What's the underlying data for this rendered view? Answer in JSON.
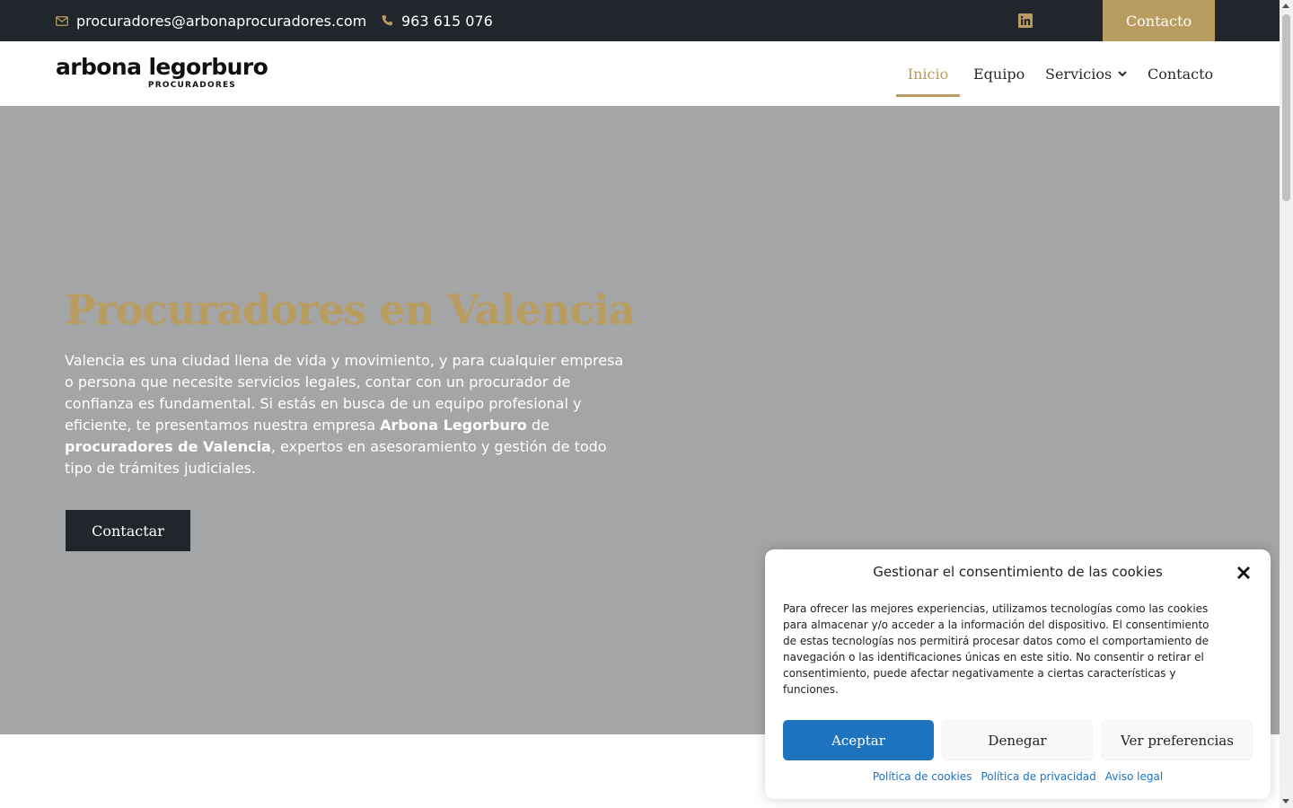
{
  "topbar": {
    "email": "procuradores@arbonaprocuradores.com",
    "phone": "963 615 076",
    "contact_button": "Contacto",
    "social_icon": "linkedin-icon"
  },
  "header": {
    "logo_main": "arbona legorburo",
    "logo_sub": "PROCURADORES",
    "nav": {
      "inicio": "Inicio",
      "equipo": "Equipo",
      "servicios": "Servicios",
      "contacto": "Contacto"
    },
    "active_item": "Inicio"
  },
  "hero": {
    "title": "Procuradores en Valencia",
    "text_part1": "Valencia es una ciudad llena de vida y movimiento, y para cualquier empresa o persona que necesite servicios legales, contar con un procurador de confianza es fundamental. Si estás en busca de un equipo profesional y eficiente, te presentamos nuestra empresa ",
    "text_bold1": "Arbona Legorburo",
    "text_part2": " de ",
    "text_bold2": "procuradores de Valencia",
    "text_part3": ", expertos en asesoramiento y gestión de todo tipo de trámites judiciales.",
    "button": "Contactar"
  },
  "cookie_dialog": {
    "title": "Gestionar el consentimiento de las cookies",
    "body": "Para ofrecer las mejores experiencias, utilizamos tecnologías como las cookies para almacenar y/o acceder a la información del dispositivo. El consentimiento de estas tecnologías nos permitirá procesar datos como el comportamiento de navegación o las identificaciones únicas en este sitio. No consentir o retirar el consentimiento, puede afectar negativamente a ciertas características y funciones.",
    "accept": "Aceptar",
    "deny": "Denegar",
    "preferences": "Ver preferencias",
    "links": {
      "cookies": "Política de cookies",
      "privacy": "Política de privacidad",
      "legal": "Aviso legal"
    }
  },
  "colors": {
    "dark": "#21252c",
    "gold": "#b89c60",
    "hero_bg": "#a4a5a7",
    "accept_blue": "#1e73be"
  }
}
